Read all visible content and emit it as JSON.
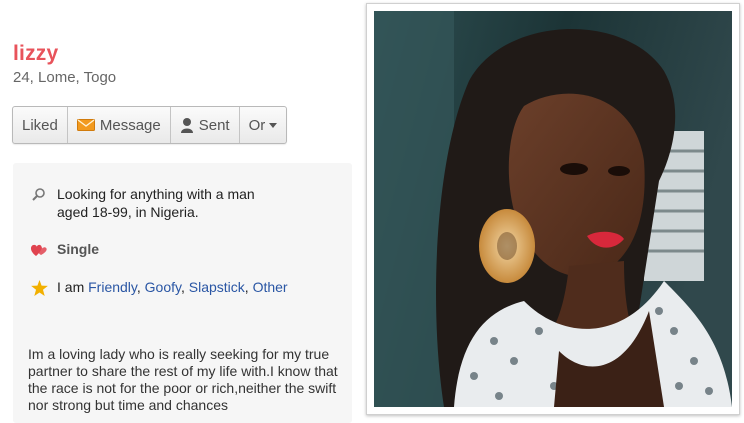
{
  "profile": {
    "name": "lizzy",
    "details": "24, Lome, Togo"
  },
  "actions": {
    "liked": "Liked",
    "message": "Message",
    "sent": "Sent",
    "more": "Or"
  },
  "info": {
    "looking_for_line1": "Looking for anything with a man",
    "looking_for_line2": "aged 18-99, in Nigeria.",
    "status": "Single",
    "personality_prefix": "I am",
    "traits": [
      "Friendly",
      "Goofy",
      "Slapstick",
      "Other"
    ]
  },
  "bio": "Im a loving lady who is really seeking for my true partner to share the rest of my life with.I know that the race is not for the poor or rich,neither the swift nor strong but time and chances",
  "icons": {
    "looking": "magnifier-icon",
    "status": "hearts-icon",
    "personality": "star-icon",
    "message": "envelope-icon",
    "sent": "person-icon",
    "more": "caret-down-icon"
  },
  "colors": {
    "name": "#e8535b",
    "link": "#2a56a4",
    "star": "#f2b000",
    "heart": "#e0434f",
    "envelope": "#f29a1e"
  }
}
